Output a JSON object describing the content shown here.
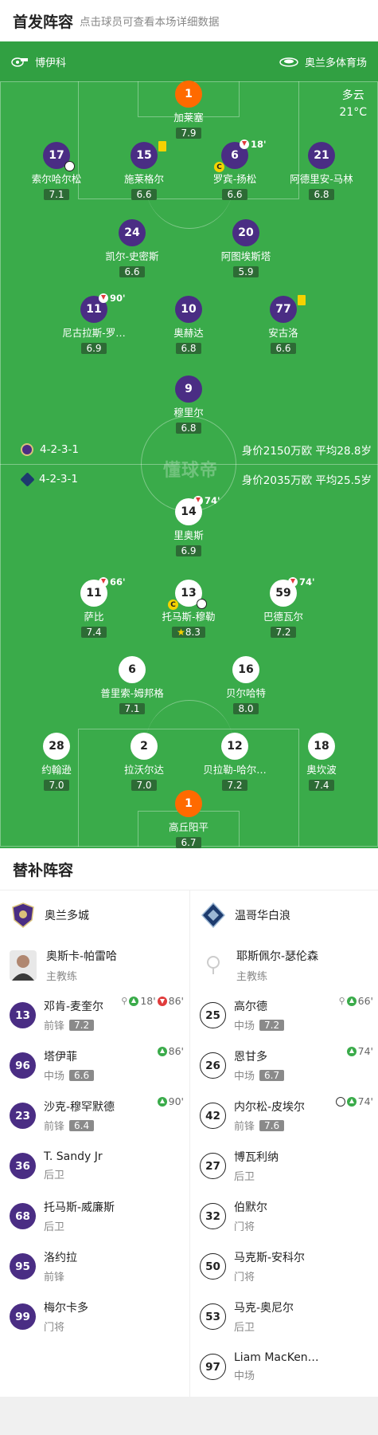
{
  "lineup": {
    "title": "首发阵容",
    "subtitle": "点击球员可查看本场详细数据"
  },
  "pitch": {
    "home_venue_label": "博伊科",
    "stadium": "奥兰多体育场",
    "weather": "多云",
    "temperature": "21°C",
    "watermark": "懂球帝",
    "home_formation": "4-2-3-1",
    "home_info": "身价2150万欧 平均28.8岁",
    "away_formation": "4-2-3-1",
    "away_info": "身价2035万欧 平均25.5岁"
  },
  "home_players": [
    {
      "no": "1",
      "name": "加莱塞",
      "rating": "7.9"
    },
    {
      "no": "17",
      "name": "索尔哈尔松",
      "rating": "7.1"
    },
    {
      "no": "15",
      "name": "施莱格尔",
      "rating": "6.6"
    },
    {
      "no": "6",
      "name": "罗宾-扬松",
      "rating": "6.6",
      "sub_min": "18'"
    },
    {
      "no": "21",
      "name": "阿德里安-马林",
      "rating": "6.8"
    },
    {
      "no": "24",
      "name": "凯尔-史密斯",
      "rating": "6.6"
    },
    {
      "no": "20",
      "name": "阿图埃斯塔",
      "rating": "5.9"
    },
    {
      "no": "11",
      "name": "尼古拉斯-罗…",
      "rating": "6.9",
      "sub_min": "90'"
    },
    {
      "no": "10",
      "name": "奥赫达",
      "rating": "6.8"
    },
    {
      "no": "77",
      "name": "安古洛",
      "rating": "6.6"
    },
    {
      "no": "9",
      "name": "穆里尔",
      "rating": "6.8"
    }
  ],
  "away_players": [
    {
      "no": "14",
      "name": "里奥斯",
      "rating": "6.9",
      "sub_min": "74'"
    },
    {
      "no": "11",
      "name": "萨比",
      "rating": "7.4",
      "sub_min": "66'"
    },
    {
      "no": "13",
      "name": "托马斯-穆勒",
      "rating": "8.3"
    },
    {
      "no": "59",
      "name": "巴德瓦尔",
      "rating": "7.2",
      "sub_min": "74'"
    },
    {
      "no": "6",
      "name": "普里索-姆邦格",
      "rating": "7.1"
    },
    {
      "no": "16",
      "name": "贝尔哈特",
      "rating": "8.0"
    },
    {
      "no": "28",
      "name": "约翰逊",
      "rating": "7.0"
    },
    {
      "no": "2",
      "name": "拉沃尔达",
      "rating": "7.0"
    },
    {
      "no": "12",
      "name": "贝拉勒-哈尔…",
      "rating": "7.2"
    },
    {
      "no": "18",
      "name": "奥坎波",
      "rating": "7.4"
    },
    {
      "no": "1",
      "name": "高丘阳平",
      "rating": "6.7"
    }
  ],
  "bench": {
    "title": "替补阵容",
    "home": {
      "team": "奥兰多城",
      "coach": {
        "name": "奥斯卡-帕雷哈",
        "role": "主教练"
      },
      "players": [
        {
          "no": "13",
          "name": "邓肯-麦奎尔",
          "pos": "前锋",
          "rating": "7.2",
          "events": [
            "18'",
            "86'"
          ]
        },
        {
          "no": "96",
          "name": "塔伊菲",
          "pos": "中场",
          "rating": "6.6",
          "events": [
            "86'"
          ]
        },
        {
          "no": "23",
          "name": "沙克-穆罕默德",
          "pos": "前锋",
          "rating": "6.4",
          "events": [
            "90'"
          ]
        },
        {
          "no": "36",
          "name": "T. Sandy Jr",
          "pos": "后卫"
        },
        {
          "no": "68",
          "name": "托马斯-威廉斯",
          "pos": "后卫"
        },
        {
          "no": "95",
          "name": "洛约拉",
          "pos": "前锋"
        },
        {
          "no": "99",
          "name": "梅尔卡多",
          "pos": "门将"
        }
      ]
    },
    "away": {
      "team": "温哥华白浪",
      "coach": {
        "name": "耶斯佩尔-瑟伦森",
        "role": "主教练"
      },
      "players": [
        {
          "no": "25",
          "name": "高尔德",
          "pos": "中场",
          "rating": "7.2",
          "events": [
            "66'"
          ]
        },
        {
          "no": "26",
          "name": "恩甘多",
          "pos": "中场",
          "rating": "6.7",
          "events": [
            "74'"
          ]
        },
        {
          "no": "42",
          "name": "内尔松-皮埃尔",
          "pos": "前锋",
          "rating": "7.6",
          "events": [
            "74'"
          ]
        },
        {
          "no": "27",
          "name": "博瓦利纳",
          "pos": "后卫"
        },
        {
          "no": "32",
          "name": "伯默尔",
          "pos": "门将"
        },
        {
          "no": "50",
          "name": "马克斯-安科尔",
          "pos": "门将"
        },
        {
          "no": "53",
          "name": "马克-奥尼尔",
          "pos": "后卫"
        },
        {
          "no": "97",
          "name": "Liam MacKen…",
          "pos": "中场"
        }
      ]
    }
  },
  "colors": {
    "pitch": "#3aab4a",
    "home": "#4a2d84",
    "gk": "#ff6a00",
    "card": "#f5d200"
  }
}
